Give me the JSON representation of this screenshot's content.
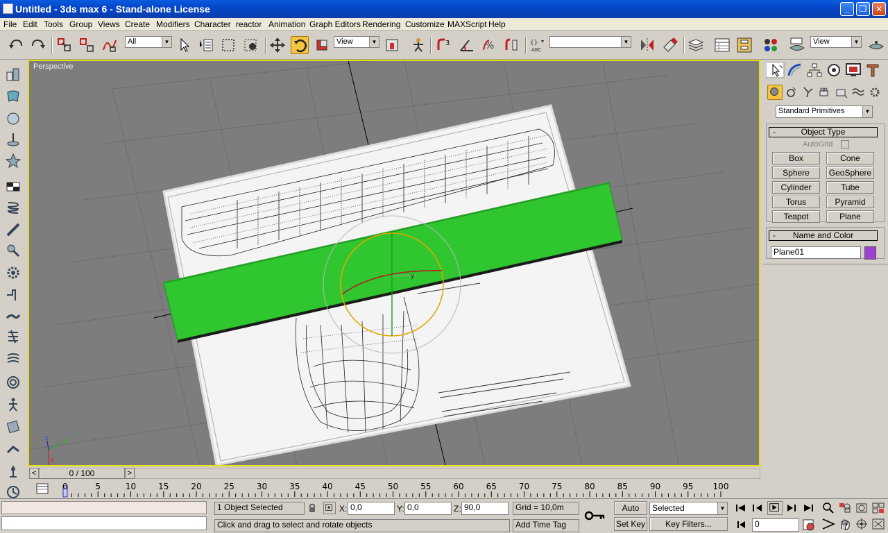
{
  "window": {
    "title": "Untitled - 3ds max 6 - Stand-alone License",
    "minimize": "_",
    "maximize": "❐",
    "close": "✕"
  },
  "menu": [
    "File",
    "Edit",
    "Tools",
    "Group",
    "Views",
    "Create",
    "Modifiers",
    "Character",
    "reactor",
    "Animation",
    "Graph Editors",
    "Rendering",
    "Customize",
    "MAXScript",
    "Help"
  ],
  "toolbar": {
    "selection_filter": "All",
    "ref_coord": "View",
    "named_selection": "",
    "view2": "View",
    "icons": [
      "undo-icon",
      "redo-icon",
      "select-link-icon",
      "unlink-icon",
      "bind-space-warp-icon",
      "select-object-icon",
      "select-by-name-icon",
      "rect-region-icon",
      "window-crossing-icon",
      "move-icon",
      "rotate-icon",
      "scale-icon",
      "pivot-icon",
      "manipulate-icon",
      "snap-3d-icon",
      "angle-snap-icon",
      "percent-snap-icon",
      "spinner-snap-icon",
      "edit-named-sel-icon",
      "mirror-icon",
      "align-icon",
      "layer-manager-icon",
      "curve-editor-icon",
      "schematic-icon",
      "material-editor-icon",
      "render-scene-icon",
      "quick-render-icon"
    ]
  },
  "viewport": {
    "label": "Perspective",
    "axis_x": "x",
    "axis_y": "y",
    "axis_z": "z",
    "gizmo_y": "y"
  },
  "cmdpanel": {
    "category": "Standard Primitives",
    "object_type_title": "Object Type",
    "autogrid_label": "AutoGrid",
    "buttons": [
      "Box",
      "Cone",
      "Sphere",
      "GeoSphere",
      "Cylinder",
      "Tube",
      "Torus",
      "Pyramid",
      "Teapot",
      "Plane"
    ],
    "name_color_title": "Name and Color",
    "object_name": "Plane01",
    "object_color": "#a040d0"
  },
  "timeslider": {
    "label": "0 / 100",
    "left_arrow": "<",
    "right_arrow": ">"
  },
  "trackbar": {
    "ticks": [
      "0",
      "5",
      "10",
      "15",
      "20",
      "25",
      "30",
      "35",
      "40",
      "45",
      "50",
      "55",
      "60",
      "65",
      "70",
      "75",
      "80",
      "85",
      "90",
      "95",
      "100"
    ]
  },
  "status": {
    "selection": "1 Object Selected",
    "prompt": "Click and drag to select and rotate objects",
    "x_label": "X:",
    "x_value": "0,0",
    "y_label": "Y:",
    "y_value": "0,0",
    "z_label": "Z:",
    "z_value": "90,0",
    "grid": "Grid = 10,0m",
    "add_time_tag": "Add Time Tag",
    "auto_key": "Auto Key",
    "set_key": "Set Key",
    "key_mode": "Selected",
    "key_filters": "Key Filters...",
    "frame": "0"
  }
}
